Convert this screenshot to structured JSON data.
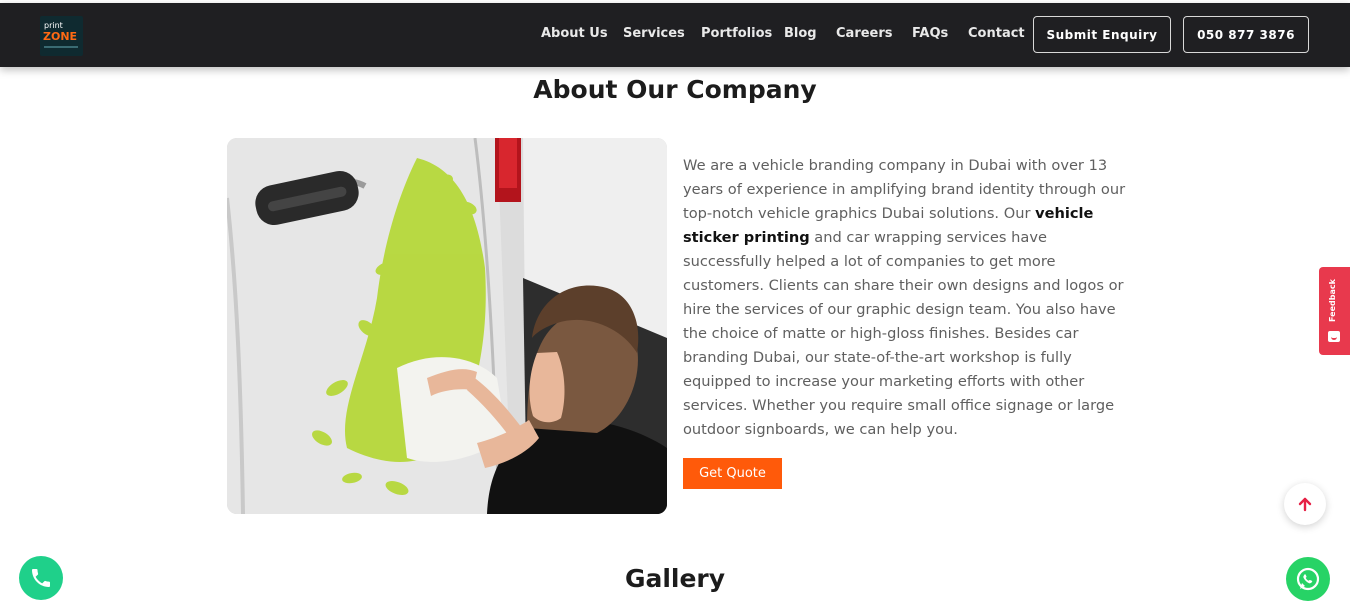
{
  "header": {
    "logo": {
      "line1": "print",
      "line2": "ZONE"
    },
    "nav": [
      "About Us",
      "Services",
      "Portfolios",
      "Blog",
      "Careers",
      "FAQs",
      "Contact"
    ],
    "submit_label": "Submit Enquiry",
    "phone_label": "050 877 3876"
  },
  "about": {
    "title": "About Our Company",
    "text_before": "We are a vehicle branding company in Dubai with over 13 years of experience in amplifying brand identity through our top-notch vehicle graphics Dubai solutions. Our ",
    "text_bold": "vehicle sticker printing",
    "text_after": " and car wrapping services have successfully helped a lot of companies to get more customers. Clients can share their own designs and logos or hire the services of our graphic design team. You also have the choice of matte or high-gloss finishes. Besides car branding Dubai, our state-of-the-art workshop is fully equipped to increase your marketing efforts with other services. Whether you require small office signage or large outdoor signboards, we can help you.",
    "cta_label": "Get Quote"
  },
  "gallery": {
    "title": "Gallery"
  },
  "widgets": {
    "feedback_label": "Feedback",
    "feedback_icon": "smile-icon",
    "scroll_top_icon": "arrow-up-icon",
    "call_icon": "phone-icon",
    "whatsapp_icon": "whatsapp-icon"
  },
  "colors": {
    "nav_bg": "#1f1f22",
    "accent_orange": "#ff5a0a",
    "feedback_red": "#e8394d",
    "float_green": "#1fd08a",
    "whatsapp_green": "#27d366",
    "decal_green": "#b6d83a"
  }
}
